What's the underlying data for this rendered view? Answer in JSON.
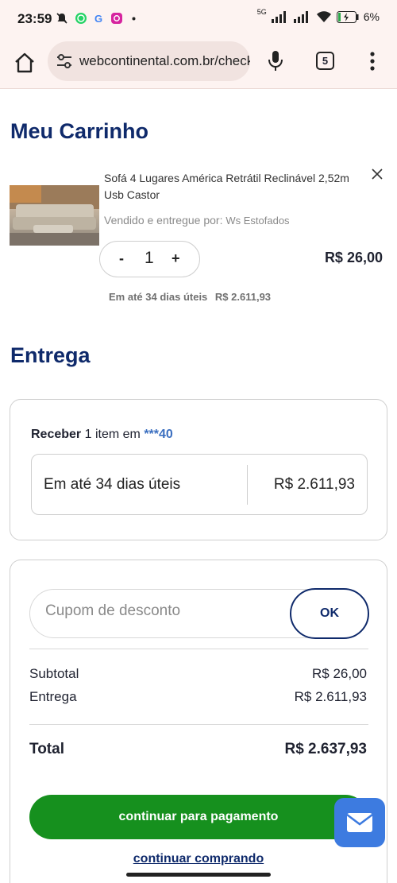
{
  "status_bar": {
    "time": "23:59",
    "network": "5G",
    "battery": "6%"
  },
  "browser": {
    "url": "webcontinental.com.br/checkout",
    "tab_count": "5"
  },
  "cart": {
    "title": "Meu Carrinho",
    "item": {
      "name": "Sofá 4 Lugares América Retrátil Reclinável 2,52m Usb Castor",
      "seller_label": "Vendido e entregue por:",
      "seller_name": "Ws Estofados",
      "quantity": "1",
      "minus": "-",
      "plus": "+",
      "price": "R$ 26,00",
      "delivery_time": "Em até 34 dias úteis",
      "delivery_price": "R$ 2.611,93"
    }
  },
  "delivery": {
    "title": "Entrega",
    "receive_label": "Receber",
    "receive_text": "1 item em",
    "cep": "***40",
    "option_label": "Em até 34 dias úteis",
    "option_price": "R$ 2.611,93"
  },
  "summary": {
    "coupon_placeholder": "Cupom de desconto",
    "coupon_button": "OK",
    "subtotal_label": "Subtotal",
    "subtotal_value": "R$ 26,00",
    "shipping_label": "Entrega",
    "shipping_value": "R$ 2.611,93",
    "total_label": "Total",
    "total_value": "R$ 2.637,93"
  },
  "actions": {
    "pay_button": "continuar para pagamento",
    "continue_link": "continuar comprando"
  },
  "colors": {
    "brand_navy": "#0f2a6b",
    "pay_green": "#16901e",
    "chat_blue": "#3d7be0",
    "link_blue": "#3b6fc0"
  }
}
